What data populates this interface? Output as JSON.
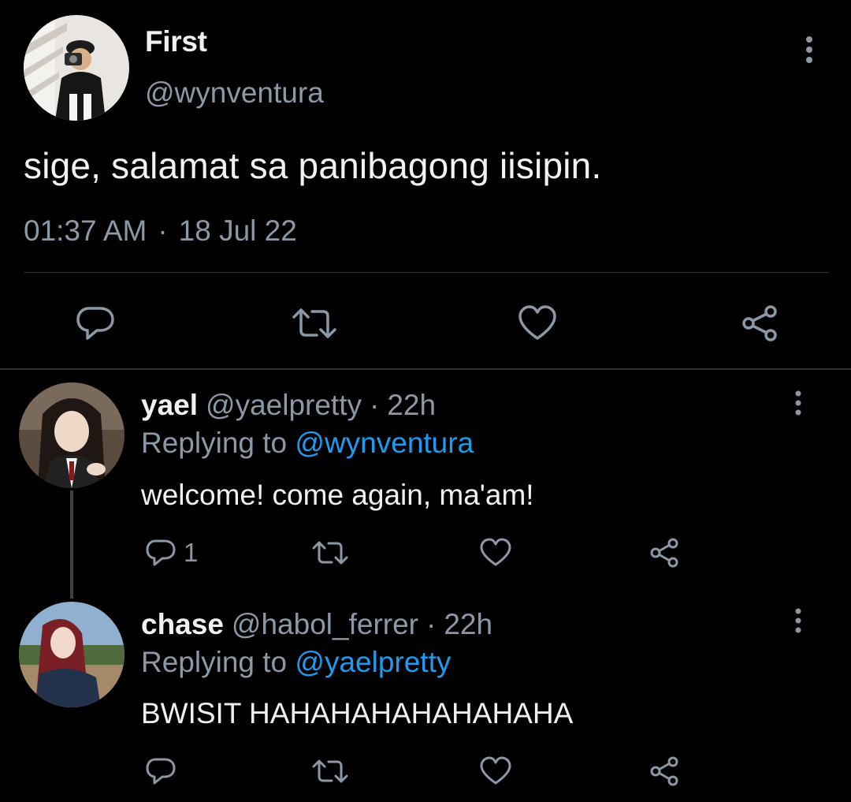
{
  "main_tweet": {
    "author_name": "First",
    "author_handle": "@wynventura",
    "text": "sige, salamat sa panibagong iisipin.",
    "time": "01:37 AM",
    "separator": "·",
    "date": "18 Jul 22",
    "actions": [
      "reply-icon",
      "retweet-icon",
      "like-icon",
      "share-icon"
    ]
  },
  "replies": [
    {
      "name": "yael",
      "handle": "@yaelpretty",
      "separator": "·",
      "time": "22h",
      "replying_prefix": "Replying to",
      "replying_to": "@wynventura",
      "text": "welcome! come again, ma'am!",
      "reply_count": "1"
    },
    {
      "name": "chase",
      "handle": "@habol_ferrer",
      "separator": "·",
      "time": "22h",
      "replying_prefix": "Replying to",
      "replying_to": "@yaelpretty",
      "text": "BWISIT HAHAHAHAHAHAHAHA",
      "reply_count": ""
    }
  ],
  "colors": {
    "background": "#000000",
    "primary_text": "#f0f0f0",
    "secondary_text": "#8b98a5",
    "mention": "#1d9bf0",
    "divider": "#2f3336"
  }
}
